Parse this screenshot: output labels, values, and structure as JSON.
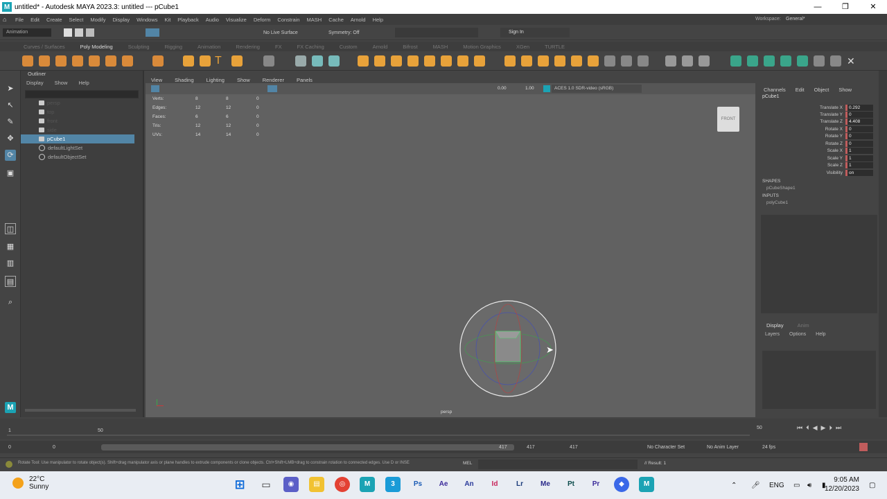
{
  "window": {
    "title": "untitled* - Autodesk MAYA 2023.3: untitled   ---   pCube1",
    "logo": "M",
    "buttons": [
      "—",
      "❐",
      "✕"
    ]
  },
  "menubar": {
    "items": [
      "File",
      "Edit",
      "Create",
      "Select",
      "Modify",
      "Display",
      "Windows",
      "Kit",
      "Playback",
      "Audio",
      "Visualize",
      "Deform",
      "Constrain",
      "MASH",
      "Cache",
      "Arnold",
      "Help"
    ],
    "workspace_label": "Workspace:",
    "workspace_value": "General*"
  },
  "statusline": {
    "mode": "Animation",
    "no_live_surface": "No Live Surface",
    "symmetry": "Symmetry: Off",
    "sign_in": "Sign In"
  },
  "shelf_tabs": [
    "Curves / Surfaces",
    "Poly Modeling",
    "Sculpting",
    "Rigging",
    "Animation",
    "Rendering",
    "FX",
    "FX Caching",
    "Custom",
    "Arnold",
    "Bifrost",
    "MASH",
    "Motion Graphics",
    "XGen",
    "TURTLE"
  ],
  "shelf_active_tab": "Poly Modeling",
  "outliner": {
    "title": "Outliner",
    "menus": [
      "Display",
      "Show",
      "Help"
    ],
    "items": [
      {
        "label": "persp",
        "type": "camera"
      },
      {
        "label": "top",
        "type": "camera"
      },
      {
        "label": "front",
        "type": "camera"
      },
      {
        "label": "side",
        "type": "camera"
      },
      {
        "label": "pCube1",
        "type": "mesh",
        "selected": true
      },
      {
        "label": "defaultLightSet",
        "type": "set"
      },
      {
        "label": "defaultObjectSet",
        "type": "set"
      }
    ]
  },
  "viewport": {
    "menus": [
      "View",
      "Shading",
      "Lighting",
      "Show",
      "Renderer",
      "Panels"
    ],
    "exposure": "0.00",
    "gamma": "1.00",
    "colorspace": "ACES 1.0 SDR-video (sRGB)",
    "hud": [
      {
        "label": "Verts:",
        "a": "8",
        "b": "8",
        "c": "0"
      },
      {
        "label": "Edges:",
        "a": "12",
        "b": "12",
        "c": "0"
      },
      {
        "label": "Faces:",
        "a": "6",
        "b": "6",
        "c": "0"
      },
      {
        "label": "Tris:",
        "a": "12",
        "b": "12",
        "c": "0"
      },
      {
        "label": "UVs:",
        "a": "14",
        "b": "14",
        "c": "0"
      }
    ],
    "viewcube": "FRONT",
    "camera": "persp"
  },
  "channelbox": {
    "menus": [
      "Channels",
      "Edit",
      "Object",
      "Show"
    ],
    "object": "pCube1",
    "attributes": [
      {
        "name": "Translate X",
        "value": "0.292"
      },
      {
        "name": "Translate Y",
        "value": "0"
      },
      {
        "name": "Translate Z",
        "value": "4.408"
      },
      {
        "name": "Rotate X",
        "value": "0"
      },
      {
        "name": "Rotate Y",
        "value": "0"
      },
      {
        "name": "Rotate Z",
        "value": "0"
      },
      {
        "name": "Scale X",
        "value": "1"
      },
      {
        "name": "Scale Y",
        "value": "1"
      },
      {
        "name": "Scale Z",
        "value": "1"
      },
      {
        "name": "Visibility",
        "value": "on"
      }
    ],
    "shapes_label": "SHAPES",
    "shape": "pCubeShape1",
    "inputs_label": "INPUTS",
    "input": "polyCube1"
  },
  "layers": {
    "tabs": [
      "Display",
      "Anim"
    ],
    "menus": [
      "Layers",
      "Options",
      "Help"
    ]
  },
  "timeline": {
    "ticks": [
      "1",
      "50"
    ],
    "end": "50",
    "range_start": "0",
    "range_inner_start": "0",
    "range_inner_end": "417",
    "range_end": "417",
    "range_end2": "417",
    "character_set": "No Character Set",
    "anim_layer": "No Anim Layer",
    "fps": "24 fps"
  },
  "cmdline": {
    "help": "Rotate Tool: Use manipulator to rotate object(s). Shift+drag manipulator axis or plane handles to extrude components or clone objects. Ctrl+Shift+LMB+drag to constrain rotation to connected edges. Use D or INSE",
    "mel": "MEL",
    "result": "// Result: 1"
  },
  "taskbar": {
    "temp": "22°C",
    "weather": "Sunny",
    "lang": "ENG",
    "time": "9:05 AM",
    "date": "12/20/2023",
    "apps": [
      "⊞",
      "▭",
      "◉",
      "▤",
      "◎",
      "M",
      "3",
      "Ps",
      "Ae",
      "An",
      "Id",
      "Lr",
      "Me",
      "Pt",
      "Pr",
      "◆",
      "M"
    ]
  },
  "colors": {
    "selection": "#5285a6",
    "viewport_bg": "#616161",
    "keyed_attr": "#c05c5c",
    "maya_teal": "#1ba3b4"
  }
}
